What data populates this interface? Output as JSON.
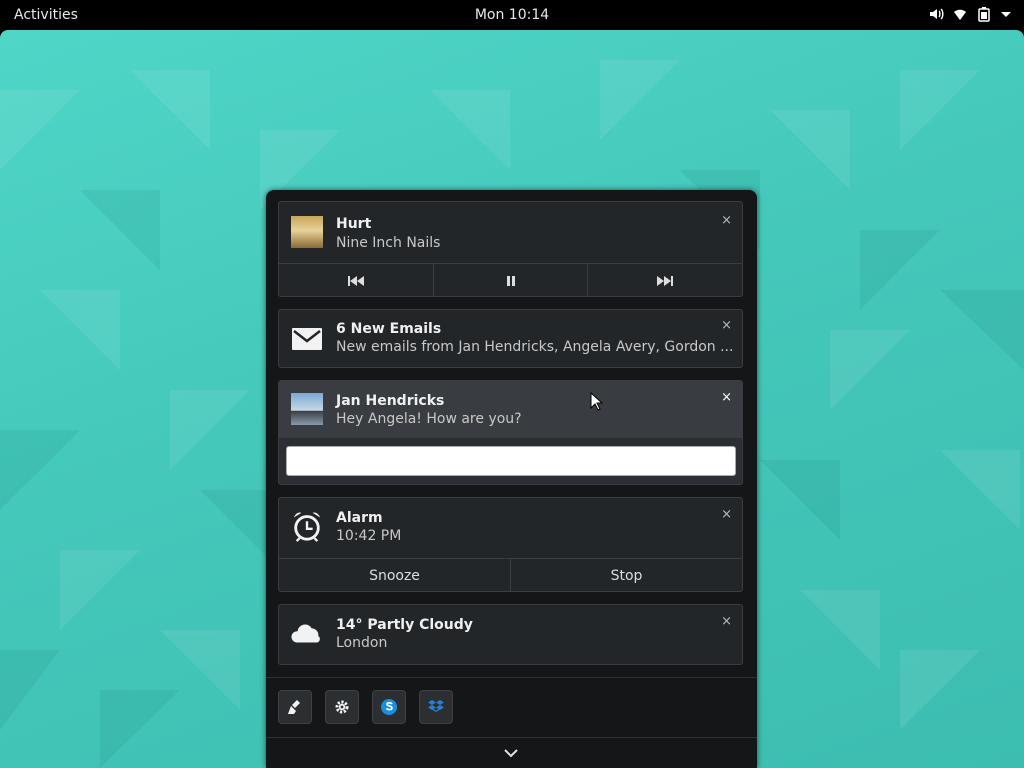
{
  "topbar": {
    "activities": "Activities",
    "clock": "Mon 10:14",
    "icons": [
      "volume-icon",
      "wifi-icon",
      "battery-icon",
      "menu-arrow-icon"
    ]
  },
  "notifications": {
    "music": {
      "title": "Hurt",
      "body": "Nine Inch Nails",
      "controls": [
        "previous-track-icon",
        "pause-icon",
        "next-track-icon"
      ]
    },
    "email": {
      "title": "6 New Emails",
      "body": "New emails from Jan Hendricks, Angela Avery, Gordon ..."
    },
    "chat": {
      "title": "Jan Hendricks",
      "body": "Hey Angela! How are you?",
      "reply_value": ""
    },
    "alarm": {
      "title": "Alarm",
      "body": "10:42 PM",
      "snooze": "Snooze",
      "stop": "Stop"
    },
    "weather": {
      "title": "14° Partly Cloudy",
      "body": "London"
    },
    "close_glyph": "×"
  },
  "dock": {
    "apps": [
      "clean-icon",
      "settings-gear-icon",
      "skype-icon",
      "dropbox-icon"
    ],
    "expand_icon": "chevron-down-icon"
  },
  "colors": {
    "desktop": "#45c9bb",
    "panel": "#141617",
    "card": "#232629",
    "chat_header": "#393d41",
    "skype": "#1a8fe0",
    "dropbox": "#2a7fd4"
  }
}
